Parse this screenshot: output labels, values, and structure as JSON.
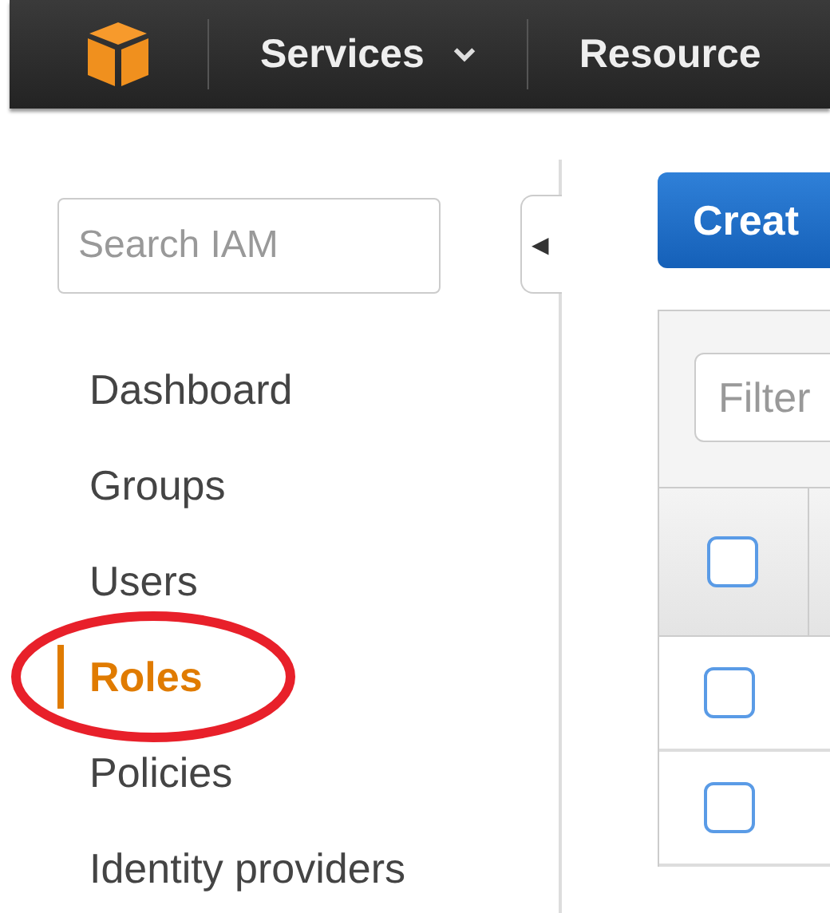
{
  "top_nav": {
    "items": [
      {
        "label": "Services",
        "has_dropdown": true
      },
      {
        "label": "Resource",
        "has_dropdown": false
      }
    ]
  },
  "sidebar": {
    "search": {
      "placeholder": "Search IAM"
    },
    "collapse_tab": {
      "label": "◀"
    },
    "items": [
      {
        "label": "Dashboard",
        "selected": false
      },
      {
        "label": "Groups",
        "selected": false
      },
      {
        "label": "Users",
        "selected": false
      },
      {
        "label": "Roles",
        "selected": true
      },
      {
        "label": "Policies",
        "selected": false
      },
      {
        "label": "Identity providers",
        "selected": false
      }
    ]
  },
  "main": {
    "create_button": "Creat",
    "filter": {
      "placeholder": "Filter"
    },
    "table": {
      "header": {
        "checked": false
      },
      "rows": [
        {
          "checked": false
        },
        {
          "checked": false
        }
      ]
    }
  },
  "annotation": {
    "kind": "ellipse"
  }
}
